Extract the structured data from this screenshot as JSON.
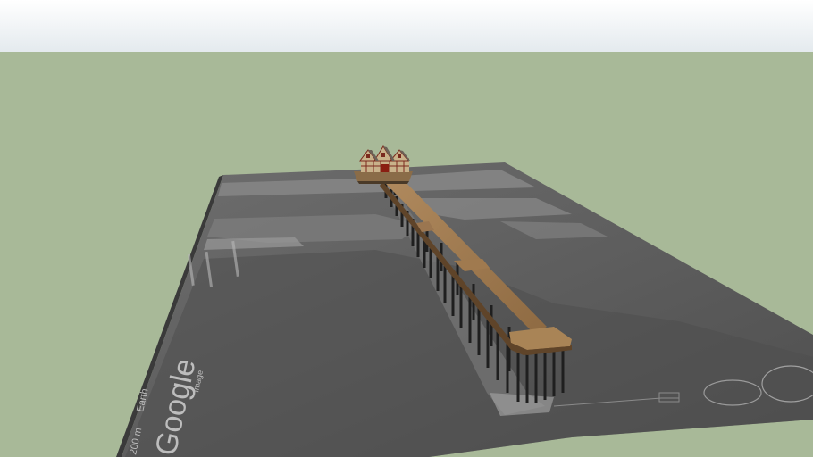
{
  "scene": {
    "sky_color": "#e4eaee",
    "ground_color": "#a8b998",
    "map_overlay": {
      "brand": "Google",
      "scale_text": "200 m",
      "attribution_line_1": "Image",
      "attribution_line_2": "Earth"
    },
    "pier": {
      "deck_color": "#a07a4f",
      "pile_color": "#2a2a2a",
      "building_wall_color": "#c9b28a",
      "building_trim_color": "#7a2a1e",
      "roof_color": "#6c6257"
    }
  }
}
